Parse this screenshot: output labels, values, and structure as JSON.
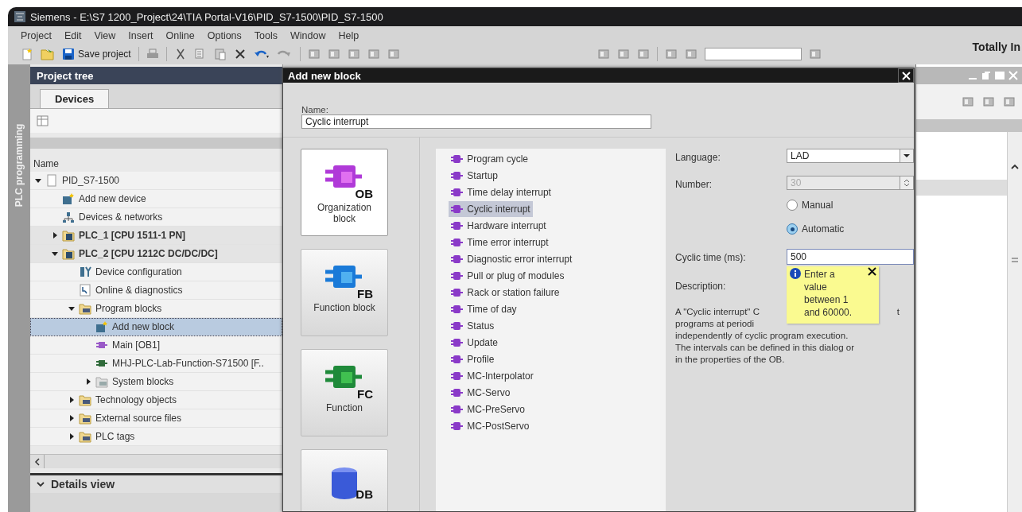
{
  "window": {
    "title": "Siemens  -  E:\\S7 1200_Project\\24\\TIA Portal-V16\\PID_S7-1500\\PID_S7-1500",
    "app_label": "Totally In"
  },
  "menu": [
    "Project",
    "Edit",
    "View",
    "Insert",
    "Online",
    "Options",
    "Tools",
    "Window",
    "Help"
  ],
  "toolbar": {
    "save_label": "Save project"
  },
  "side_tab": {
    "label": "PLC programming"
  },
  "project_tree": {
    "title": "Project tree",
    "tabs": [
      {
        "label": "Devices",
        "selected": true
      }
    ],
    "column": "Name",
    "items": [
      {
        "label": "PID_S7-1500",
        "kind": "project",
        "expanded": true,
        "selected": false,
        "children": [
          {
            "label": "Add new device",
            "kind": "add",
            "selected": false
          },
          {
            "label": "Devices & networks",
            "kind": "network",
            "selected": false
          },
          {
            "label": "PLC_1 [CPU 1511-1 PN]",
            "kind": "plc",
            "expanded": false,
            "selected": false
          },
          {
            "label": "PLC_2 [CPU 1212C DC/DC/DC]",
            "kind": "plc",
            "expanded": true,
            "selected": false,
            "children": [
              {
                "label": "Device configuration",
                "kind": "config",
                "selected": false
              },
              {
                "label": "Online & diagnostics",
                "kind": "diag",
                "selected": false
              },
              {
                "label": "Program blocks",
                "kind": "folder",
                "expanded": true,
                "selected": false,
                "children": [
                  {
                    "label": "Add new block",
                    "kind": "add",
                    "selected": true
                  },
                  {
                    "label": "Main [OB1]",
                    "kind": "ob",
                    "selected": false
                  },
                  {
                    "label": "MHJ-PLC-Lab-Function-S71500 [F..",
                    "kind": "fb",
                    "selected": false
                  },
                  {
                    "label": "System blocks",
                    "kind": "sysfolder",
                    "expanded": false,
                    "selected": false
                  }
                ]
              },
              {
                "label": "Technology objects",
                "kind": "folder",
                "expanded": false,
                "selected": false
              },
              {
                "label": "External source files",
                "kind": "folder",
                "expanded": false,
                "selected": false
              },
              {
                "label": "PLC tags",
                "kind": "folder",
                "expanded": false,
                "selected": false
              }
            ]
          }
        ]
      }
    ],
    "details": {
      "label": "Details view",
      "expanded": false
    }
  },
  "dialog": {
    "title": "Add new block",
    "name_label": "Name:",
    "name_value": "Cyclic interrupt",
    "block_types": [
      {
        "kind": "ob",
        "tag": "OB",
        "label": "Organization block",
        "selected": true
      },
      {
        "kind": "fb",
        "tag": "FB",
        "label": "Function block",
        "selected": false
      },
      {
        "kind": "fc",
        "tag": "FC",
        "label": "Function",
        "selected": false
      },
      {
        "kind": "db",
        "tag": "DB",
        "selected": false
      }
    ],
    "ob_types": [
      {
        "label": "Program cycle",
        "selected": false
      },
      {
        "label": "Startup",
        "selected": false
      },
      {
        "label": "Time delay interrupt",
        "selected": false
      },
      {
        "label": "Cyclic interrupt",
        "selected": true
      },
      {
        "label": "Hardware interrupt",
        "selected": false
      },
      {
        "label": "Time error interrupt",
        "selected": false
      },
      {
        "label": "Diagnostic error interrupt",
        "selected": false
      },
      {
        "label": "Pull or plug of modules",
        "selected": false
      },
      {
        "label": "Rack or station failure",
        "selected": false
      },
      {
        "label": "Time of day",
        "selected": false
      },
      {
        "label": "Status",
        "selected": false
      },
      {
        "label": "Update",
        "selected": false
      },
      {
        "label": "Profile",
        "selected": false
      },
      {
        "label": "MC-Interpolator",
        "selected": false
      },
      {
        "label": "MC-Servo",
        "selected": false
      },
      {
        "label": "MC-PreServo",
        "selected": false
      },
      {
        "label": "MC-PostServo",
        "selected": false
      }
    ],
    "language": {
      "label": "Language:",
      "value": "LAD"
    },
    "number": {
      "label": "Number:",
      "value": "30",
      "disabled": true
    },
    "number_modes": [
      {
        "label": "Manual",
        "selected": false
      },
      {
        "label": "Automatic",
        "selected": true
      }
    ],
    "cyclic_time": {
      "label": "Cyclic time (ms):",
      "value": "500"
    },
    "tooltip": {
      "lines": [
        "Enter a",
        "value",
        "between 1",
        "and 60000."
      ]
    },
    "description": {
      "label": "Description:",
      "lines": [
        [
          "A \"Cyclic interrupt\" C",
          "t"
        ],
        [
          "programs at periodi"
        ],
        [
          "independently of cyclic program execution."
        ],
        [
          "The intervals can be defined in this dialog or"
        ],
        [
          "in the properties of the OB."
        ]
      ]
    }
  }
}
